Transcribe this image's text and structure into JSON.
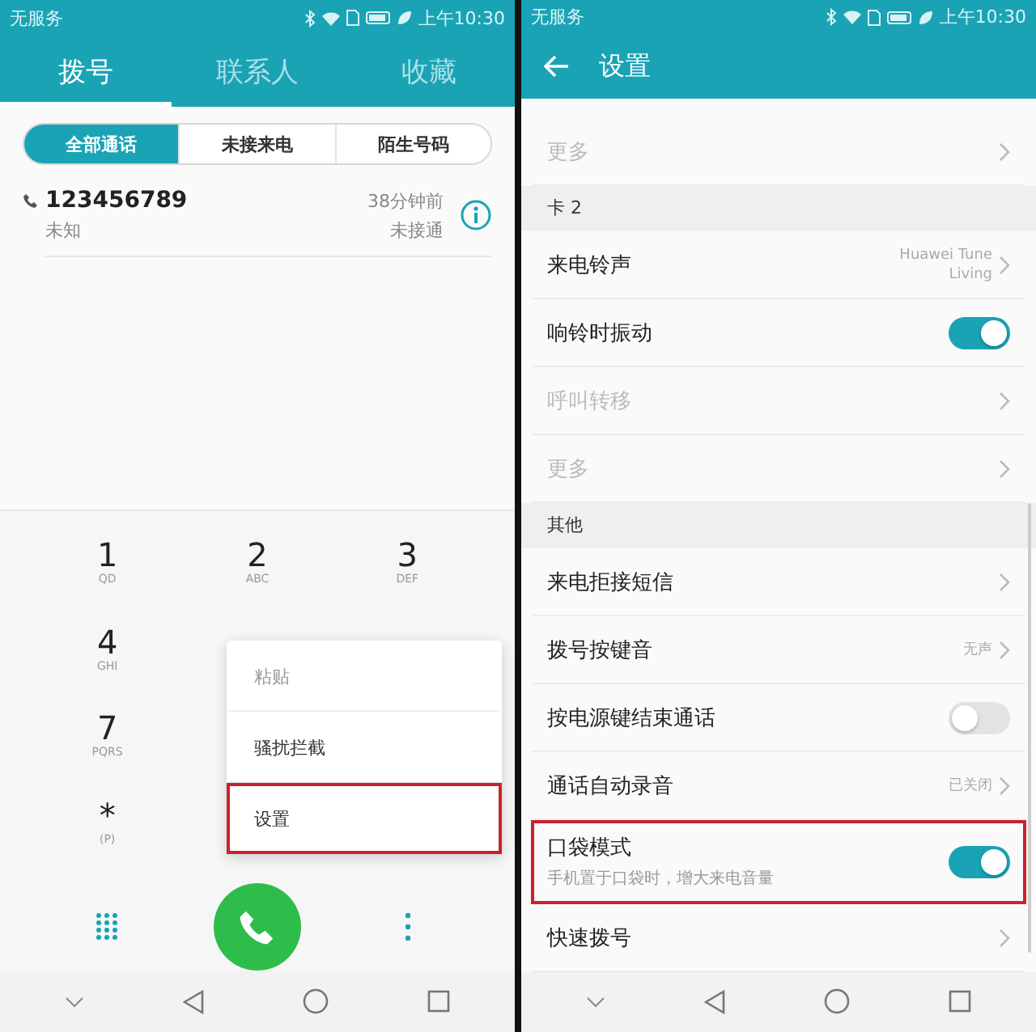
{
  "left": {
    "status_bar": {
      "carrier": "无服务",
      "time": "上午10:30"
    },
    "tabs": [
      {
        "label": "拨号",
        "selected": true
      },
      {
        "label": "联系人",
        "selected": false
      },
      {
        "label": "收藏",
        "selected": false
      }
    ],
    "filters": [
      {
        "label": "全部通话",
        "selected": true
      },
      {
        "label": "未接来电",
        "selected": false
      },
      {
        "label": "陌生号码",
        "selected": false
      }
    ],
    "calls": [
      {
        "number": "123456789",
        "label": "未知",
        "time": "38分钟前",
        "status": "未接通"
      }
    ],
    "keypad": [
      [
        {
          "digit": "1",
          "letters": "QD"
        },
        {
          "digit": "2",
          "letters": "ABC"
        },
        {
          "digit": "3",
          "letters": "DEF"
        }
      ],
      [
        {
          "digit": "4",
          "letters": "GHI"
        }
      ],
      [
        {
          "digit": "7",
          "letters": "PQRS"
        }
      ],
      [
        {
          "digit": "*",
          "letters": "(P)"
        }
      ]
    ],
    "menu": [
      {
        "label": "粘贴",
        "disabled": true,
        "highlighted": false
      },
      {
        "label": "骚扰拦截",
        "disabled": false,
        "highlighted": false
      },
      {
        "label": "设置",
        "disabled": false,
        "highlighted": true
      }
    ]
  },
  "right": {
    "status_bar": {
      "carrier": "无服务",
      "time": "上午10:30"
    },
    "title": "设置",
    "items": [
      {
        "kind": "link",
        "label": "更多",
        "disabled": true
      },
      {
        "kind": "header",
        "label": "卡 2"
      },
      {
        "kind": "link",
        "label": "来电铃声",
        "value": "Huawei Tune Living",
        "disabled": false
      },
      {
        "kind": "toggle",
        "label": "响铃时振动",
        "on": true
      },
      {
        "kind": "link",
        "label": "呼叫转移",
        "disabled": true
      },
      {
        "kind": "link",
        "label": "更多",
        "disabled": true
      },
      {
        "kind": "header",
        "label": "其他"
      },
      {
        "kind": "link",
        "label": "来电拒接短信",
        "disabled": false
      },
      {
        "kind": "link",
        "label": "拨号按键音",
        "value": "无声",
        "disabled": false
      },
      {
        "kind": "toggle",
        "label": "按电源键结束通话",
        "on": false
      },
      {
        "kind": "link",
        "label": "通话自动录音",
        "value": "已关闭",
        "disabled": false
      },
      {
        "kind": "toggle",
        "label": "口袋模式",
        "subtitle": "手机置于口袋时，增大来电音量",
        "on": true,
        "highlighted": true
      },
      {
        "kind": "link",
        "label": "快速拨号",
        "disabled": false
      }
    ]
  }
}
